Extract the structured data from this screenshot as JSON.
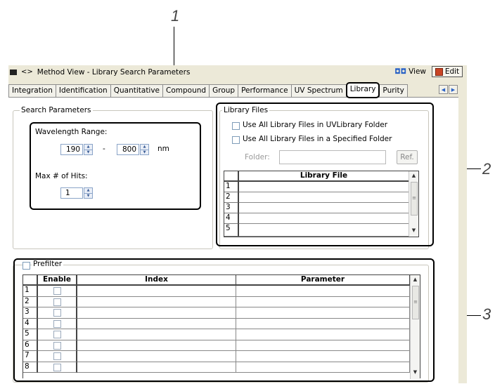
{
  "callouts": [
    "1",
    "2",
    "3"
  ],
  "window": {
    "title": "Method View - Library Search Parameters",
    "view_label": "View",
    "edit_label": "Edit"
  },
  "tabs": [
    "Integration",
    "Identification",
    "Quantitative",
    "Compound",
    "Group",
    "Performance",
    "UV Spectrum",
    "Library",
    "Purity"
  ],
  "search_params": {
    "group_label": "Search Parameters",
    "wavelength_label": "Wavelength Range:",
    "wavelength_min": "190",
    "dash": "-",
    "wavelength_max": "800",
    "unit": "nm",
    "max_hits_label": "Max # of Hits:",
    "max_hits": "1"
  },
  "library_files": {
    "group_label": "Library Files",
    "option_uvlibrary": "Use All Library Files in UVLibrary Folder",
    "option_specified": "Use All Library Files in a Specified Folder",
    "folder_label": "Folder:",
    "folder_value": "",
    "ref_button": "Ref.",
    "table_header": "Library File",
    "rows": [
      "1",
      "2",
      "3",
      "4",
      "5"
    ]
  },
  "prefilter": {
    "label": "Prefilter",
    "columns": [
      "Enable",
      "Index",
      "Parameter"
    ],
    "rows": [
      "1",
      "2",
      "3",
      "4",
      "5",
      "6",
      "7",
      "8"
    ]
  }
}
